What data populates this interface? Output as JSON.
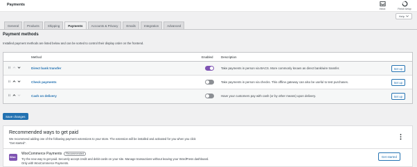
{
  "page": {
    "title": "Payments"
  },
  "top_actions": [
    {
      "label": "Inbox",
      "icon": "inbox-icon"
    },
    {
      "label": "Finish setup",
      "icon": "progress-ring-icon"
    }
  ],
  "help": {
    "label": "Help"
  },
  "tabs": [
    {
      "label": "General",
      "active": false
    },
    {
      "label": "Products",
      "active": false
    },
    {
      "label": "Shipping",
      "active": false
    },
    {
      "label": "Payments",
      "active": true
    },
    {
      "label": "Accounts & Privacy",
      "active": false
    },
    {
      "label": "Emails",
      "active": false
    },
    {
      "label": "Integration",
      "active": false
    },
    {
      "label": "Advanced",
      "active": false
    }
  ],
  "payment_methods": {
    "title": "Payment methods",
    "description": "Installed payment methods are listed below and can be sorted to control their display order on the frontend.",
    "columns": {
      "method": "Method",
      "enabled": "Enabled",
      "description": "Description"
    },
    "rows": [
      {
        "name": "Direct bank transfer",
        "enabled": true,
        "description": "Take payments in person via BACS. More commonly known as direct bank/wire transfer.",
        "action": "Set up"
      },
      {
        "name": "Check payments",
        "enabled": false,
        "description": "Take payments in person via checks. This offline gateway can also be useful to test purchases.",
        "action": "Set up"
      },
      {
        "name": "Cash on delivery",
        "enabled": false,
        "description": "Have your customers pay with cash (or by other means) upon delivery.",
        "action": "Set up"
      }
    ]
  },
  "save_button": {
    "label": "Save changes"
  },
  "recommended": {
    "title": "Recommended ways to get paid",
    "description": "We recommend adding one of the following payment extensions to your store. The extension will be installed and activated for you when you click \"Get started\".",
    "extension": {
      "logo_text": "Woo",
      "name": "WooCommerce Payments",
      "badge": "Recommended",
      "description": "Try the new way to get paid. Securely accept credit and debit cards on your site. Manage transactions without leaving your WordPress dashboard. Only with WooCommerce Payments.",
      "action": "Get started"
    }
  },
  "colors": {
    "accent": "#2271b1",
    "toggle_on": "#7f54b3",
    "toggle_off": "#8c8f94",
    "save_bg": "#2271b1"
  }
}
